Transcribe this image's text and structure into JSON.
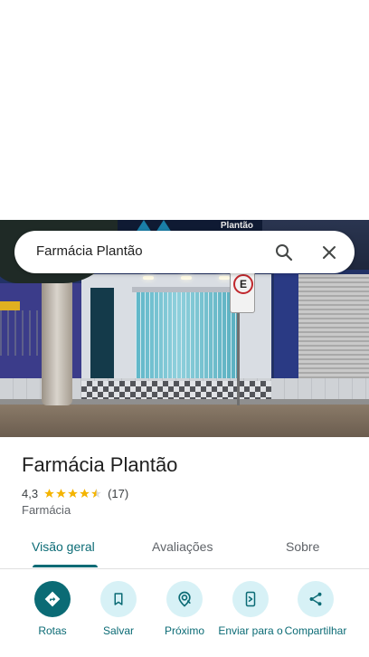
{
  "search": {
    "query": "Farmácia Plantão"
  },
  "hero": {
    "sign_text": "Plantão"
  },
  "place": {
    "name": "Farmácia Plantão",
    "rating": "4,3",
    "rating_value": 4.3,
    "reviews": "(17)",
    "category": "Farmácia"
  },
  "tabs": [
    {
      "label": "Visão geral",
      "active": true
    },
    {
      "label": "Avaliações",
      "active": false
    },
    {
      "label": "Sobre",
      "active": false
    }
  ],
  "actions": [
    {
      "label": "Rotas",
      "icon": "directions-icon"
    },
    {
      "label": "Salvar",
      "icon": "bookmark-icon"
    },
    {
      "label": "Próximo",
      "icon": "nearby-icon"
    },
    {
      "label": "Enviar para o",
      "icon": "send-to-phone-icon"
    },
    {
      "label": "Compartilhar",
      "icon": "share-icon"
    }
  ],
  "colors": {
    "accent": "#0b6b75",
    "action_bg": "#d7f1f6",
    "star": "#f4b400"
  }
}
